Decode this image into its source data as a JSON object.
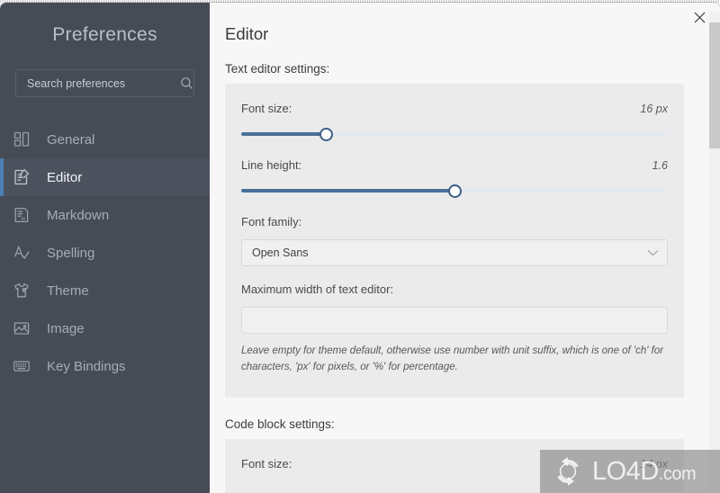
{
  "window": {
    "close_label": "×"
  },
  "sidebar": {
    "title": "Preferences",
    "search": {
      "placeholder": "Search preferences",
      "value": "",
      "icon": "search-icon"
    },
    "items": [
      {
        "label": "General",
        "icon": "layout-grid-icon",
        "active": false
      },
      {
        "label": "Editor",
        "icon": "edit-document-icon",
        "active": true
      },
      {
        "label": "Markdown",
        "icon": "markdown-file-icon",
        "active": false
      },
      {
        "label": "Spelling",
        "icon": "spellcheck-icon",
        "active": false
      },
      {
        "label": "Theme",
        "icon": "tshirt-icon",
        "active": false
      },
      {
        "label": "Image",
        "icon": "image-icon",
        "active": false
      },
      {
        "label": "Key Bindings",
        "icon": "keyboard-icon",
        "active": false
      }
    ]
  },
  "main": {
    "title": "Editor",
    "sections": [
      {
        "label": "Text editor settings:",
        "fields": {
          "font_size": {
            "label": "Font size:",
            "value": "16 px",
            "slider_percent": 20
          },
          "line_height": {
            "label": "Line height:",
            "value": "1.6",
            "slider_percent": 50
          },
          "font_family": {
            "label": "Font family:",
            "value": "Open Sans",
            "chevron": "chevron-down-icon"
          },
          "max_width": {
            "label": "Maximum width of text editor:",
            "value": "",
            "placeholder": "",
            "help": "Leave empty for theme default, otherwise use number with unit suffix, which is one of 'ch' for characters, 'px' for pixels, or '%' for percentage."
          }
        }
      },
      {
        "label": "Code block settings:",
        "fields": {
          "font_size": {
            "label": "Font size:",
            "value": "14 px"
          }
        }
      }
    ]
  },
  "watermark": {
    "text": "LO4D",
    "suffix": ".com"
  },
  "colors": {
    "sidebar_bg": "#464b55",
    "sidebar_active": "#4c525d",
    "accent": "#4d7fb5",
    "panel_bg": "#ebebeb",
    "content_bg": "#f7f7f7",
    "slider_fill": "#4a6f99"
  }
}
